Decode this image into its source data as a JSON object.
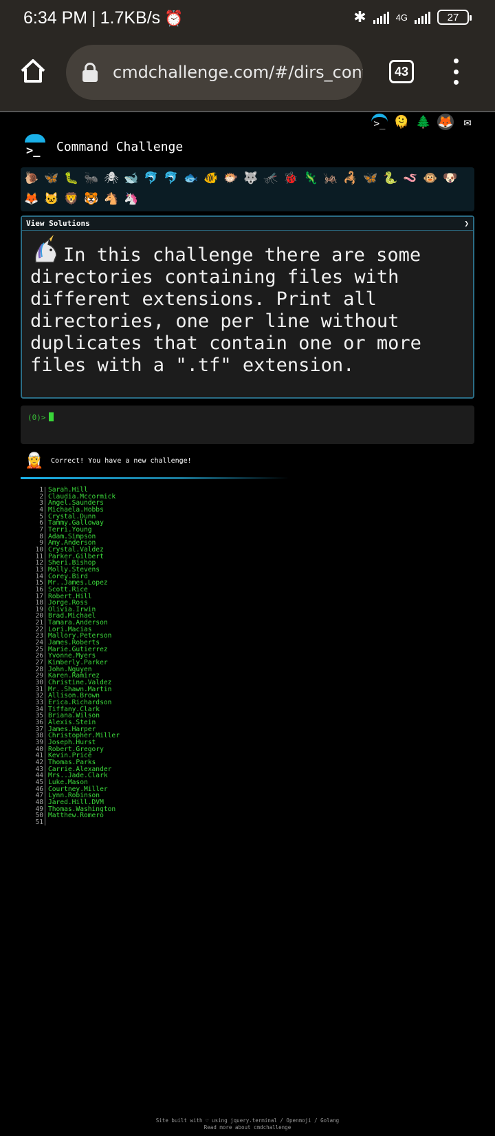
{
  "status_bar": {
    "time": "6:34 PM",
    "separator": "|",
    "speed": "1.7KB/s",
    "alarm_icon": "alarm-clock",
    "bluetooth_icon": "bluetooth",
    "network": "4G",
    "battery": "27"
  },
  "browser": {
    "url": "cmdchallenge.com/#/dirs_containi",
    "tab_count": "43"
  },
  "header": {
    "title": "Command Challenge",
    "top_icons": [
      "terminal-icon",
      "skull-icon",
      "tree-icon",
      "gitlab-icon",
      "mail-icon"
    ]
  },
  "animals": [
    "🐌",
    "🦋",
    "🐛",
    "🐜",
    "🕷",
    "🐋",
    "🐬",
    "🐬",
    "🐟",
    "🐠",
    "🐡",
    "🐺",
    "🦟",
    "🐞",
    "🦎",
    "🦗",
    "🦂",
    "🦋",
    "🐍",
    "🪱",
    "🐵",
    "🐶",
    "🦊",
    "🐱",
    "🦁",
    "🐯",
    "🐴",
    "🦄"
  ],
  "challenge": {
    "header_label": "View Solutions",
    "toggle": "❯",
    "text": "In this challenge there are some directories containing files with different extensions. Print all directories, one per line without duplicates that contain one or more files with a \".tf\" extension."
  },
  "terminal": {
    "prompt": "(0)>"
  },
  "result": {
    "message": "Correct! You have a new challenge!"
  },
  "output_lines": [
    "Sarah.Hill",
    "Claudia.Mccormick",
    "Angel.Saunders",
    "Michaela.Hobbs",
    "Crystal.Dunn",
    "Tammy.Galloway",
    "Terri.Young",
    "Adam.Simpson",
    "Amy.Anderson",
    "Crystal.Valdez",
    "Parker.Gilbert",
    "Sheri.Bishop",
    "Molly.Stevens",
    "Corey.Bird",
    "Mr..James.Lopez",
    "Scott.Rice",
    "Robert.Hill",
    "Jorge.Ross",
    "Olivia.Irwin",
    "Brad.Michael",
    "Tamara.Anderson",
    "Lori.Macias",
    "Mallory.Peterson",
    "James.Roberts",
    "Marie.Gutierrez",
    "Yvonne.Myers",
    "Kimberly.Parker",
    "John.Nguyen",
    "Karen.Ramirez",
    "Christine.Valdez",
    "Mr..Shawn.Martin",
    "Allison.Brown",
    "Erica.Richardson",
    "Tiffany.Clark",
    "Briana.Wilson",
    "Alexis.Stein",
    "James.Harper",
    "Christopher.Miller",
    "Joseph.Hurst",
    "Robert.Gregory",
    "Kevin.Price",
    "Thomas.Parks",
    "Carrie.Alexander",
    "Mrs..Jade.Clark",
    "Luke.Mason",
    "Courtney.Miller",
    "Lynn.Robinson",
    "Jared.Hill.DVM",
    "Thomas.Washington",
    "Matthew.Romero",
    ""
  ],
  "footer": {
    "line1": "Site built with ♡ using jquery.terminal / Openmoji / Golang",
    "line2": "Read more about cmdchallenge"
  }
}
